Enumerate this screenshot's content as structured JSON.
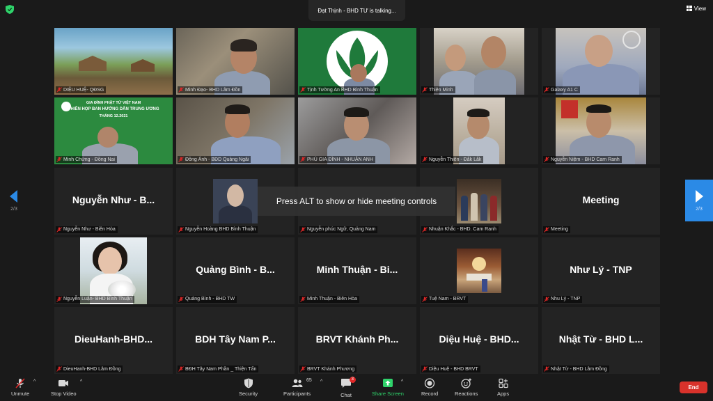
{
  "talking_indicator": "Đạt Thịnh - BHD TƯ is talking...",
  "view_label": "View",
  "overlay_hint": "Press ALT to show or hide meeting controls",
  "pagination": {
    "left": "2/3",
    "right": "2/3"
  },
  "logo_tile": {
    "line1": "GIA ĐÌNH PHẬT TỬ VIỆT NAM",
    "line2": "PHIÊN HỌP BAN HƯỚNG DẪN TRUNG ƯƠNG",
    "line3": "THÁNG 12.2021"
  },
  "tiles": [
    {
      "label": "DIỆU HUỆ- QĐSG",
      "type": "video"
    },
    {
      "label": "Minh Đạo- BHD Lâm Đồn",
      "type": "video"
    },
    {
      "label": "Tịnh Tường An BHD Bình Thuận",
      "type": "video"
    },
    {
      "label": "Thiện Minh",
      "type": "video"
    },
    {
      "label": "Galaxy A1 C",
      "type": "video"
    },
    {
      "label": "Minh Chứng - Đồng Nai",
      "type": "video"
    },
    {
      "label": "Đồng Ánh - BĐD Quảng Ngãi",
      "type": "video"
    },
    {
      "label": "PHÚ GIA ĐÌNH - NHUẬN ANH",
      "type": "video"
    },
    {
      "label": "Nguyễn Thiện - Đắk Lắk",
      "type": "video"
    },
    {
      "label": "Nguyễn Niệm - BHD Cam Ranh",
      "type": "video"
    },
    {
      "label": "Nguyễn Như - Biên Hòa",
      "big": "Nguyễn Như - B...",
      "type": "name"
    },
    {
      "label": "Nguyễn Hoàng BHD Bình Thuận",
      "type": "blank"
    },
    {
      "label": "Nguyễn phúc Ngữ, Quảng Nam",
      "type": "blank"
    },
    {
      "label": "Nhuận Khắc - BHD. Cam Ranh",
      "type": "thumb"
    },
    {
      "label": "Meeting",
      "big": "Meeting",
      "type": "name"
    },
    {
      "label": "Nguyễn Luận- BHD Bình Thuận",
      "type": "thumb"
    },
    {
      "label": "Quảng Bình - BHD TW",
      "big": "Quảng Bình - B...",
      "type": "name"
    },
    {
      "label": "Minh Thuận - Biên Hòa",
      "big": "Minh Thuận - Bi...",
      "type": "name"
    },
    {
      "label": "Tuệ Nam - BRVT",
      "type": "thumb"
    },
    {
      "label": "Nhu Lý - TNP",
      "big": "Như Lý - TNP",
      "type": "name"
    },
    {
      "label": "DieuHanh-BHD Lâm Đồng",
      "big": "DieuHanh-BHD...",
      "type": "name"
    },
    {
      "label": "BĐH Tây Nam Phần _ Thiện Tấn",
      "big": "BDH Tây Nam P...",
      "type": "name"
    },
    {
      "label": "BRVT Khánh Phương",
      "big": "BRVT Khánh Ph...",
      "type": "name"
    },
    {
      "label": "Diệu Huệ - BHD BRVT",
      "big": "Diệu Huệ - BHD...",
      "type": "name"
    },
    {
      "label": "Nhật Từ - BHD Lâm Đồng",
      "big": "Nhật Từ - BHD L...",
      "type": "name"
    }
  ],
  "toolbar": {
    "unmute": "Unmute",
    "stop_video": "Stop Video",
    "security": "Security",
    "participants": "Participants",
    "participants_count": "65",
    "chat": "Chat",
    "chat_badge": "3",
    "share_screen": "Share Screen",
    "record": "Record",
    "reactions": "Reactions",
    "apps": "Apps",
    "end": "End"
  },
  "colors": {
    "accent_blue": "#2b8ae6",
    "end_red": "#d9322b",
    "share_green": "#2fd36b",
    "muted_red": "#e02828"
  }
}
